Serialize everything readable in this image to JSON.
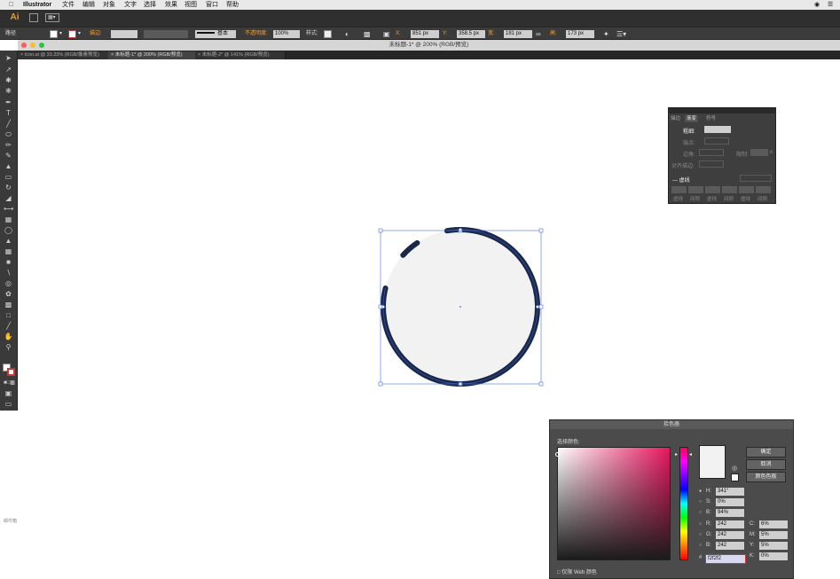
{
  "menubar": {
    "app": "Illustrator",
    "items": [
      "文件",
      "编辑",
      "对象",
      "文字",
      "选择",
      "效果",
      "视图",
      "窗口",
      "帮助"
    ]
  },
  "appbar": {
    "logo": "Ai"
  },
  "controlbar": {
    "selection": "路径",
    "stroke_label": "描边:",
    "stroke_style": "基本",
    "opacity_label": "不透明度:",
    "opacity_value": "100%",
    "style_label": "样式:",
    "x_label": "X:",
    "x_value": "851 px",
    "y_label": "Y:",
    "y_value": "358.5 px",
    "w_label": "宽:",
    "w_value": "181 px",
    "h_label": "高:",
    "h_value": "173 px"
  },
  "window": {
    "title": "未标题-1* @ 200% (RGB/预览)"
  },
  "tabs": [
    {
      "label": "Icon.ai @ 33.33% (RGB/像素预览)",
      "active": false
    },
    {
      "label": "未标题-1* @ 200% (RGB/预览)",
      "active": true
    },
    {
      "label": "未标题-2* @ 141% (RGB/预览)",
      "active": false
    }
  ],
  "side_label": "邮件箱",
  "stroke_panel": {
    "tabs": [
      "描边",
      "渐变",
      "符号"
    ],
    "weight_label": "粗细:",
    "cap_label": "端点:",
    "corner_label": "边角:",
    "limit_label": "限制:",
    "limit_suffix": "x",
    "align_label": "对齐描边:",
    "dashed_label": "虚线",
    "dash_labels": [
      "虚线",
      "间隙",
      "虚线",
      "间隙",
      "虚线",
      "间隙"
    ]
  },
  "color_picker": {
    "title": "拾色器",
    "select_label": "选择颜色:",
    "ok": "确定",
    "cancel": "取消",
    "swatches": "颜色色板",
    "hsb": [
      {
        "label": "H:",
        "value": "341°"
      },
      {
        "label": "S:",
        "value": "0%"
      },
      {
        "label": "B:",
        "value": "94%"
      }
    ],
    "rgb": [
      {
        "label": "R:",
        "value": "242"
      },
      {
        "label": "G:",
        "value": "242"
      },
      {
        "label": "B:",
        "value": "242"
      }
    ],
    "cmyk": [
      {
        "label": "C:",
        "value": "6%"
      },
      {
        "label": "M:",
        "value": "5%"
      },
      {
        "label": "Y:",
        "value": "5%"
      },
      {
        "label": "K:",
        "value": "0%"
      }
    ],
    "hex_label": "#",
    "hex_value": "f2f2f2",
    "web_only": "仅限 Web 颜色"
  },
  "colors": {
    "ring": "#1a2747",
    "ring_highlight": "#2c4a9a",
    "fill": "#f2f2f2",
    "selection": "#4a6fe0"
  }
}
